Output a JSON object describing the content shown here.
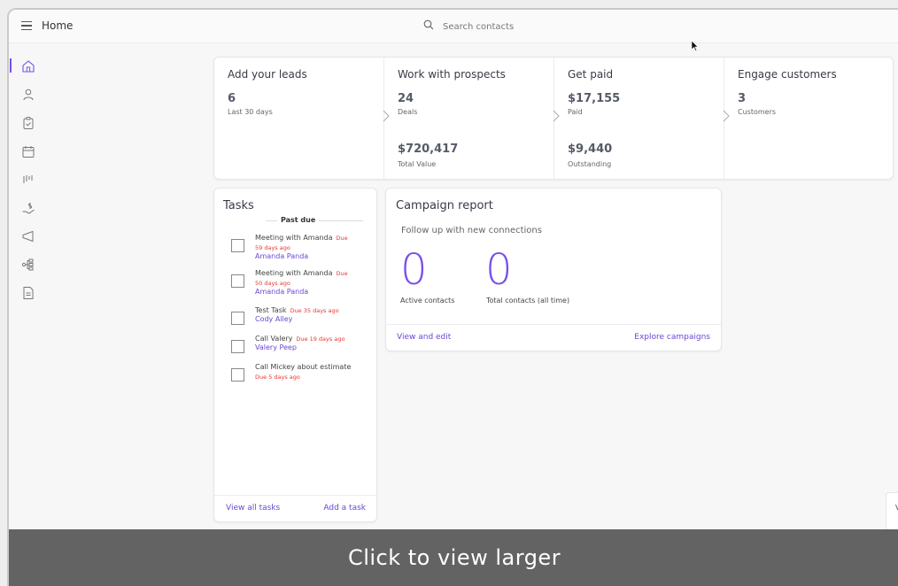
{
  "topbar": {
    "title": "Home",
    "search_placeholder": "Search contacts"
  },
  "sidebar": {
    "items": [
      {
        "icon": "home-icon",
        "active": true
      },
      {
        "icon": "person-icon"
      },
      {
        "icon": "clipboard-check-icon"
      },
      {
        "icon": "calendar-icon"
      },
      {
        "icon": "pipeline-icon"
      },
      {
        "icon": "money-hand-icon"
      },
      {
        "icon": "megaphone-icon"
      },
      {
        "icon": "workflow-icon"
      },
      {
        "icon": "document-icon"
      }
    ]
  },
  "pipeline": {
    "leads": {
      "title": "Add your leads",
      "value": "6",
      "label": "Last 30 days"
    },
    "prospects": {
      "title": "Work with prospects",
      "value": "24",
      "label": "Deals",
      "value2": "$720,417",
      "label2": "Total Value"
    },
    "paid": {
      "title": "Get paid",
      "value": "$17,155",
      "label": "Paid",
      "value2": "$9,440",
      "label2": "Outstanding"
    },
    "customers": {
      "title": "Engage customers",
      "value": "3",
      "label": "Customers"
    }
  },
  "tasks": {
    "title": "Tasks",
    "section": "Past due",
    "items": [
      {
        "name": "Meeting with Amanda",
        "due_inline": "Due",
        "due_line": "59 days ago",
        "contact": "Amanda Panda"
      },
      {
        "name": "Meeting with Amanda",
        "due_inline": "Due",
        "due_line": "50 days ago",
        "contact": "Amanda Panda"
      },
      {
        "name": "Test Task",
        "due_inline": "Due 35 days ago",
        "contact": "Cody Alley"
      },
      {
        "name": "Call Valery",
        "due_inline": "Due 19 days ago",
        "contact": "Valery Peep"
      },
      {
        "name": "Call Mickey about estimate",
        "due_line": "Due 5 days ago"
      }
    ],
    "view_all": "View all tasks",
    "add": "Add a task"
  },
  "campaign": {
    "title": "Campaign report",
    "subtitle": "Follow up with new connections",
    "active_value": "0",
    "active_label": "Active contacts",
    "total_value": "0",
    "total_label": "Total contacts (all time)",
    "view_edit": "View and edit",
    "explore": "Explore campaigns"
  },
  "peek_text": "V",
  "overlay": {
    "text": "Click to view larger"
  },
  "colors": {
    "accent": "#7a4fe8",
    "link": "#6b47d6",
    "due": "#e53935",
    "overlay": "#636363"
  }
}
